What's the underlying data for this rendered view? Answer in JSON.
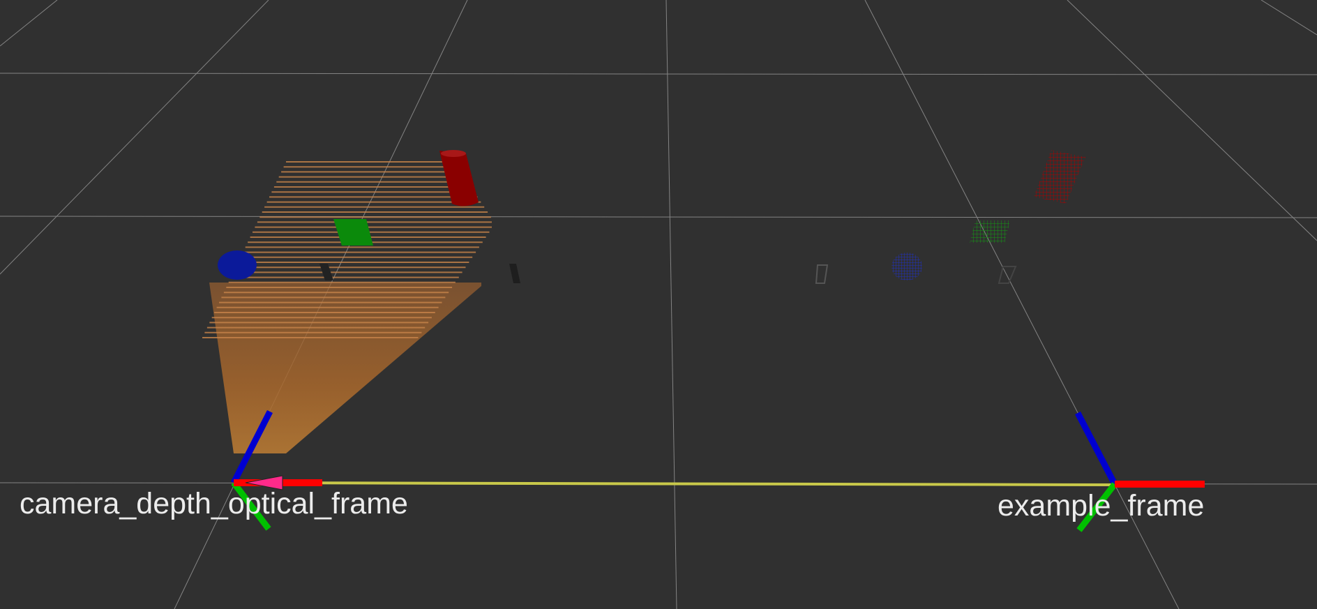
{
  "viewport": {
    "background_color": "#303030",
    "grid_color": "#a0a0a0",
    "tf_link_color": "#c8c84a"
  },
  "frames": [
    {
      "name": "camera_depth_optical_frame"
    },
    {
      "name": "example_frame"
    }
  ],
  "axis_colors": {
    "x": "#ff0000",
    "y": "#00c000",
    "z": "#0000d0"
  },
  "markers": {
    "cylinder_color": "#8a0000",
    "cube_color": "#0b8a0b",
    "sphere_color": "#0b1a9a",
    "arrow_color": "#ff2a8a",
    "point_cloud_color": "#b8743a"
  }
}
